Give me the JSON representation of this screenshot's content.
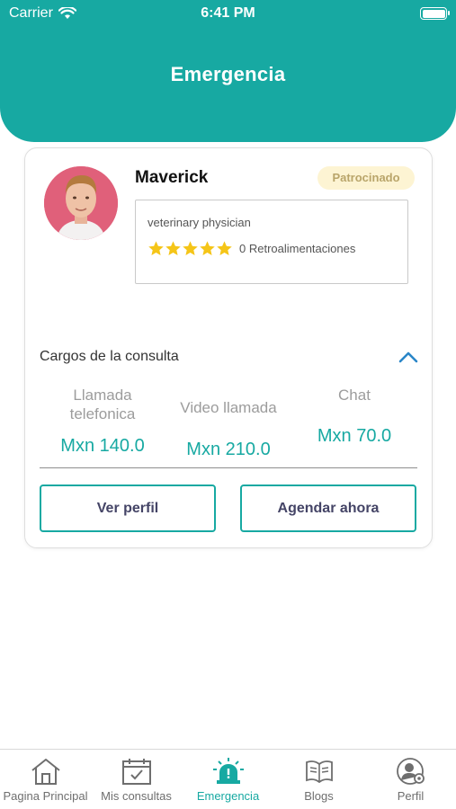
{
  "status_bar": {
    "carrier": "Carrier",
    "time": "6:41 PM"
  },
  "header": {
    "title": "Emergencia"
  },
  "doctor": {
    "name": "Maverick",
    "badge": "Patrocinado",
    "specialty": "veterinary physician",
    "rating": 5,
    "reviews": "0 Retroalimentaciones"
  },
  "charges": {
    "title": "Cargos de la consulta",
    "items": [
      {
        "label": "Llamada telefonica",
        "price": "Mxn 140.0"
      },
      {
        "label": "Video llamada",
        "price": "Mxn 210.0"
      },
      {
        "label": "Chat",
        "price": "Mxn 70.0"
      }
    ]
  },
  "buttons": {
    "profile": "Ver perfil",
    "schedule": "Agendar ahora"
  },
  "tabs": [
    {
      "label": "Pagina Principal",
      "icon": "home-icon"
    },
    {
      "label": "Mis consultas",
      "icon": "calendar-check-icon"
    },
    {
      "label": "Emergencia",
      "icon": "siren-icon",
      "active": true
    },
    {
      "label": "Blogs",
      "icon": "book-icon"
    },
    {
      "label": "Perfil",
      "icon": "user-settings-icon"
    }
  ],
  "colors": {
    "primary": "#17a9a2",
    "star": "#f5c518",
    "badge_bg": "#fdf4d3"
  }
}
